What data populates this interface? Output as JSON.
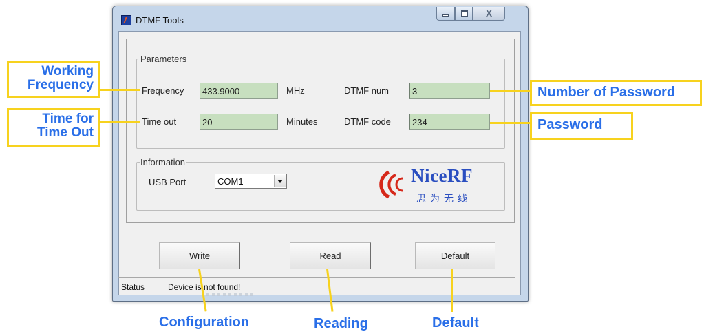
{
  "window": {
    "title": "DTMF Tools",
    "close_glyph": "X"
  },
  "parameters": {
    "legend": "Parameters",
    "frequency_label": "Frequency",
    "frequency_value": "433.9000",
    "frequency_unit": "MHz",
    "timeout_label": "Time out",
    "timeout_value": "20",
    "timeout_unit": "Minutes",
    "dtmf_num_label": "DTMF num",
    "dtmf_num_value": "3",
    "dtmf_code_label": "DTMF code",
    "dtmf_code_value": "234"
  },
  "information": {
    "legend": "Information",
    "usb_port_label": "USB Port",
    "usb_port_value": "COM1",
    "logo_name": "NiceRF",
    "logo_cn": "思为无线"
  },
  "buttons": {
    "write": "Write",
    "read": "Read",
    "default": "Default"
  },
  "status": {
    "label": "Status",
    "message": "Device is not found!"
  },
  "annotations": {
    "working_frequency": "Working Frequency",
    "time_for_time_out": "Time for Time Out",
    "number_of_password": "Number of Password",
    "password": "Password",
    "configuration": "Configuration",
    "reading": "Reading",
    "default": "Default"
  },
  "colors": {
    "accent_yellow": "#f7d21e",
    "annotation_blue": "#2a6fe8",
    "field_green": "#c7dfbf",
    "logo_blue": "#2a4ec0",
    "logo_red": "#d6281a"
  }
}
